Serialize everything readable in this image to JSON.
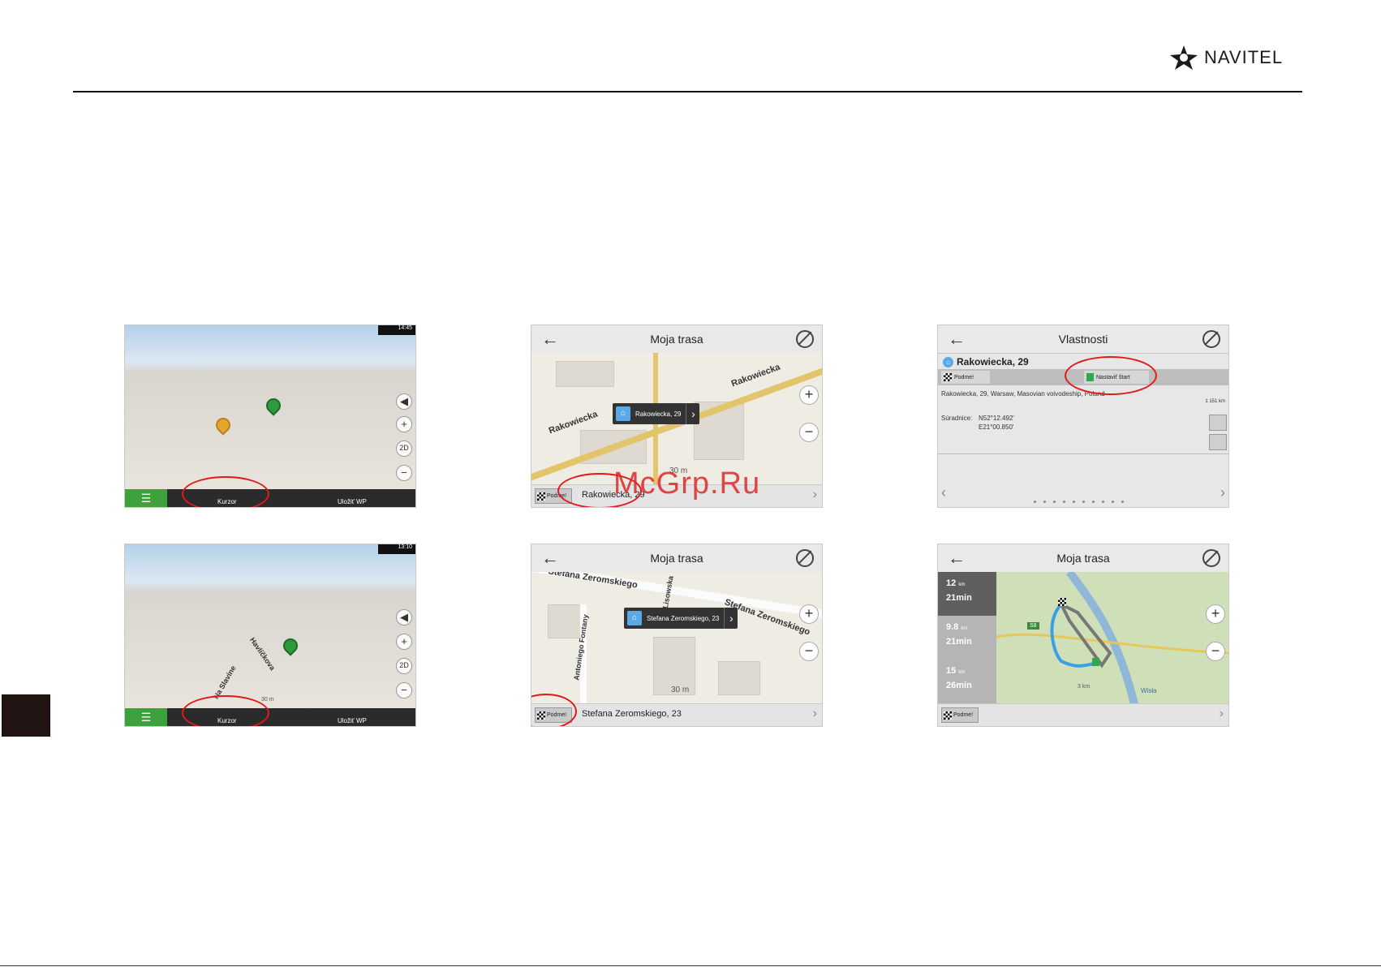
{
  "brand": {
    "logo_text": "NAVITEL"
  },
  "watermark": "McGrp.Ru",
  "screens": {
    "s1": {
      "time": "14:45",
      "btn_cursor": "Kurzor",
      "btn_save_wp": "Uložiť WP"
    },
    "s2": {
      "title": "Moja trasa",
      "street_a": "Rakowiecka",
      "street_b": "Rakowiecka",
      "callout": "Rakowiecka, 29",
      "go_label": "Podme!",
      "address": "Rakowiecka, 29",
      "scale": "30 m"
    },
    "s3": {
      "title": "Vlastnosti",
      "place": "Rakowiecka, 29",
      "go_label": "Podme!",
      "set_start": "Nastaviť štart",
      "full_address": "Rakowiecka, 29, Warsaw, Masovian voivodeship, Poland",
      "distance": "1 151 km",
      "coords_label": "Súradnice:",
      "lat": "N52°12.492'",
      "lon": "E21°00.850'"
    },
    "s4": {
      "time": "13:10",
      "street_a": "Na Slavíne",
      "street_b": "Havlíčkova",
      "btn_cursor": "Kurzor",
      "btn_save_wp": "Uložiť WP",
      "scale": "30 m"
    },
    "s5": {
      "title": "Moja trasa",
      "street_a": "Stefana Zeromskiego",
      "street_b": "Stefana Zeromskiego",
      "street_c": "Antoniego Fontany",
      "street_d": "Lisowska",
      "callout": "Stefana Zeromskiego, 23",
      "go_label": "Podme!",
      "address": "Stefana Zeromskiego, 23",
      "scale": "30 m"
    },
    "s6": {
      "title": "Moja trasa",
      "routes": [
        {
          "dist": "12",
          "unit": "km",
          "time": "21min"
        },
        {
          "dist": "9.8",
          "unit": "km",
          "time": "21min"
        },
        {
          "dist": "15",
          "unit": "km",
          "time": "26min"
        }
      ],
      "river": "Wisła",
      "road_badge": "S8",
      "scale": "3 km",
      "go_label": "Podme!"
    }
  }
}
